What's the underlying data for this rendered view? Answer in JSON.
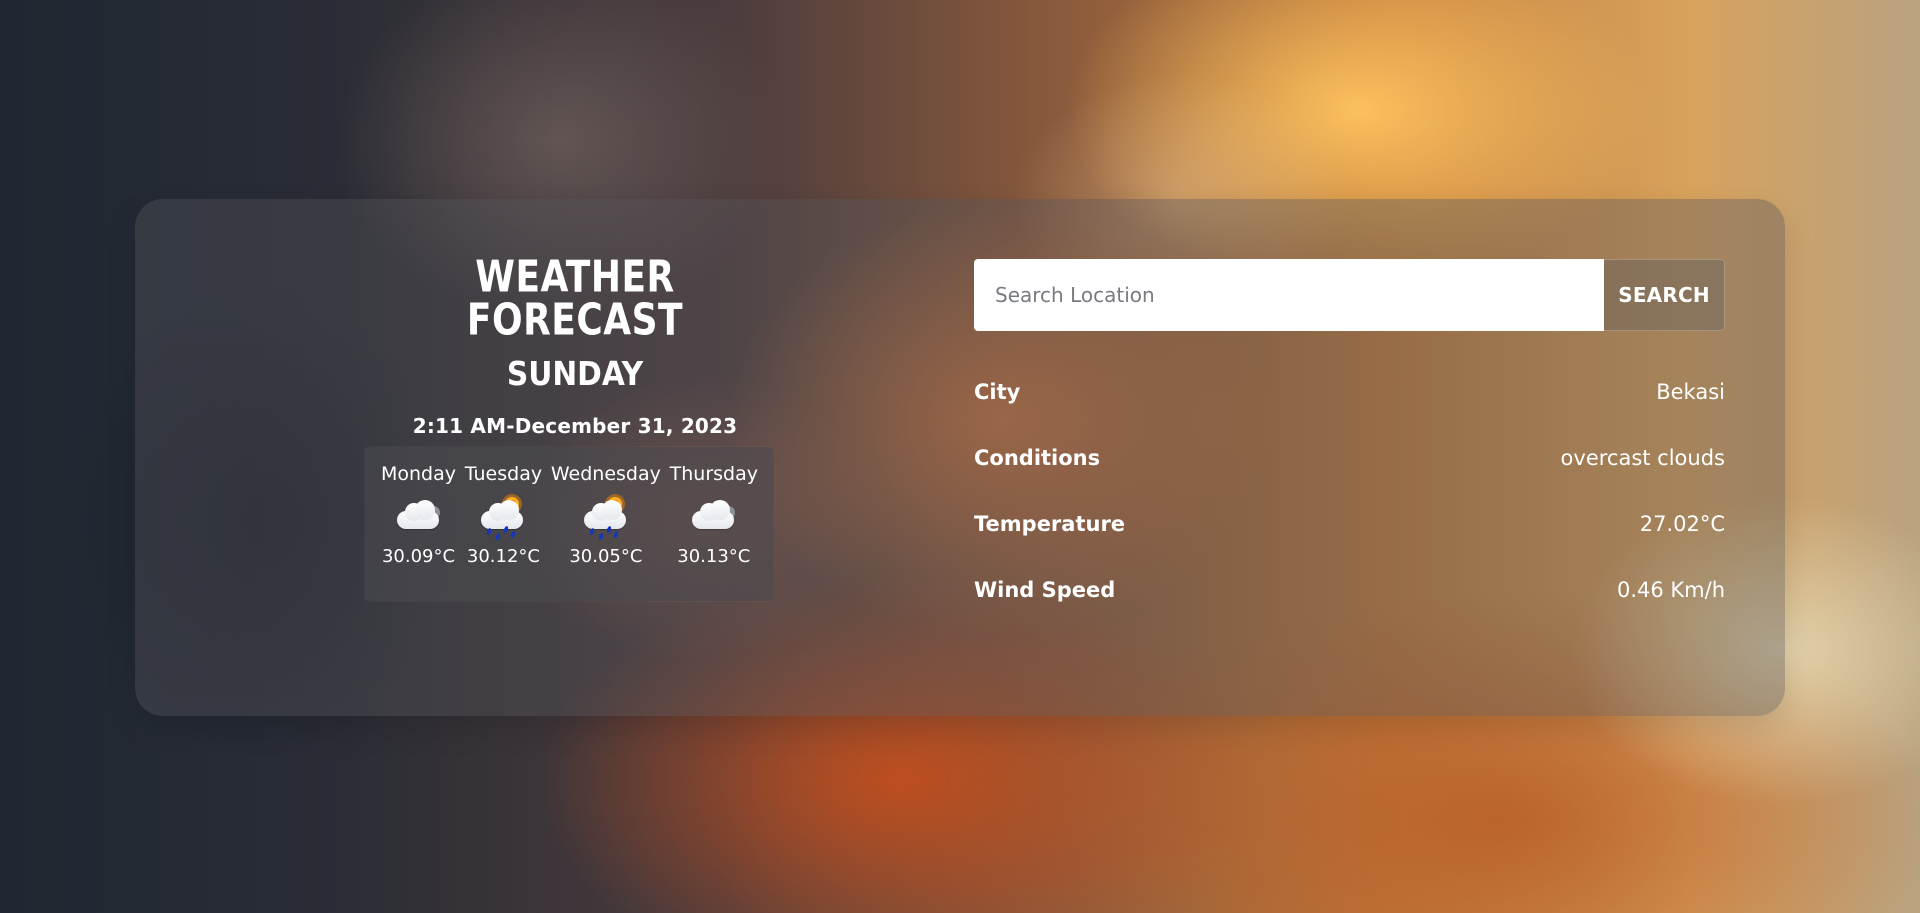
{
  "background": {
    "type": "sunset-cloud-image"
  },
  "header": {
    "title": "WEATHER FORECAST",
    "day": "SUNDAY",
    "datetime": "2:11 AM-December 31, 2023"
  },
  "forecast": {
    "items": [
      {
        "day": "Monday",
        "icon": "overcast-cloud-icon",
        "temp": "30.09°C"
      },
      {
        "day": "Tuesday",
        "icon": "rain-sun-cloud-icon",
        "temp": "30.12°C"
      },
      {
        "day": "Wednesday",
        "icon": "rain-sun-cloud-icon",
        "temp": "30.05°C"
      },
      {
        "day": "Thursday",
        "icon": "overcast-cloud-icon",
        "temp": "30.13°C"
      }
    ]
  },
  "search": {
    "placeholder": "Search Location",
    "value": "",
    "button_label": "SEARCH"
  },
  "details": [
    {
      "label": "City",
      "value": "Bekasi"
    },
    {
      "label": "Conditions",
      "value": "overcast clouds"
    },
    {
      "label": "Temperature",
      "value": "27.02°C"
    },
    {
      "label": "Wind Speed",
      "value": "0.46 Km/h"
    }
  ],
  "colors": {
    "panel_overlay": "#55555a",
    "text": "#ffffff",
    "search_input": "#ffffff",
    "rain_drop": "#1636b8",
    "sun_orange": "#ffb21f",
    "sun_red": "#ff4c0a"
  }
}
